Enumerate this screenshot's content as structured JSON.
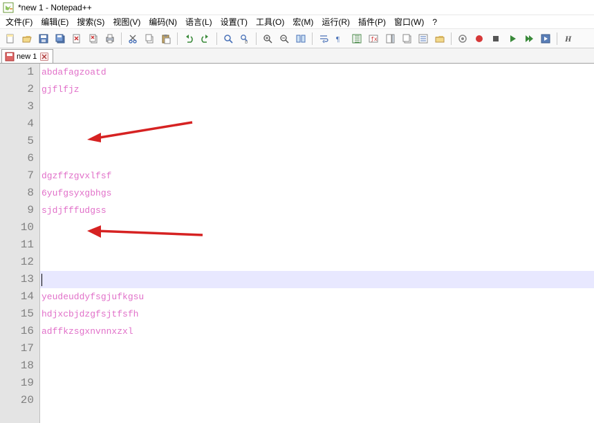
{
  "window": {
    "title": "*new 1 - Notepad++"
  },
  "menu": {
    "items": [
      {
        "label": "文件(F)"
      },
      {
        "label": "编辑(E)"
      },
      {
        "label": "搜索(S)"
      },
      {
        "label": "视图(V)"
      },
      {
        "label": "编码(N)"
      },
      {
        "label": "语言(L)"
      },
      {
        "label": "设置(T)"
      },
      {
        "label": "工具(O)"
      },
      {
        "label": "宏(M)"
      },
      {
        "label": "运行(R)"
      },
      {
        "label": "插件(P)"
      },
      {
        "label": "窗口(W)"
      },
      {
        "label": "?"
      }
    ]
  },
  "toolbar": {
    "icons": [
      "new",
      "open",
      "save",
      "save-all",
      "close",
      "close-all",
      "print",
      "|",
      "cut",
      "copy",
      "paste",
      "|",
      "undo",
      "redo",
      "|",
      "find",
      "replace",
      "|",
      "zoom-in",
      "zoom-out",
      "sync",
      "|",
      "word-wrap",
      "show-all",
      "indent-guide",
      "language",
      "doc-map",
      "doc-list",
      "func-list",
      "folder",
      "|",
      "monitor",
      "record",
      "play",
      "stop",
      "play-macro",
      "|",
      "show-symbol"
    ]
  },
  "tab": {
    "name": "new 1",
    "modified": true
  },
  "editor": {
    "total_lines": 20,
    "current_line": 13,
    "lines": [
      "abdafagzoatd",
      "gjflfjz",
      "",
      "",
      "",
      "",
      "dgzffzgvxlfsf",
      "6yufgsyxgbhgs",
      "sjdjfffudgss",
      "",
      "",
      "",
      "",
      "yeudeuddyfsgjufkgsu",
      "hdjxcbjdzgfsjtfsfh",
      "adffkzsgxnvnnxzxl",
      "",
      "",
      "",
      ""
    ]
  }
}
